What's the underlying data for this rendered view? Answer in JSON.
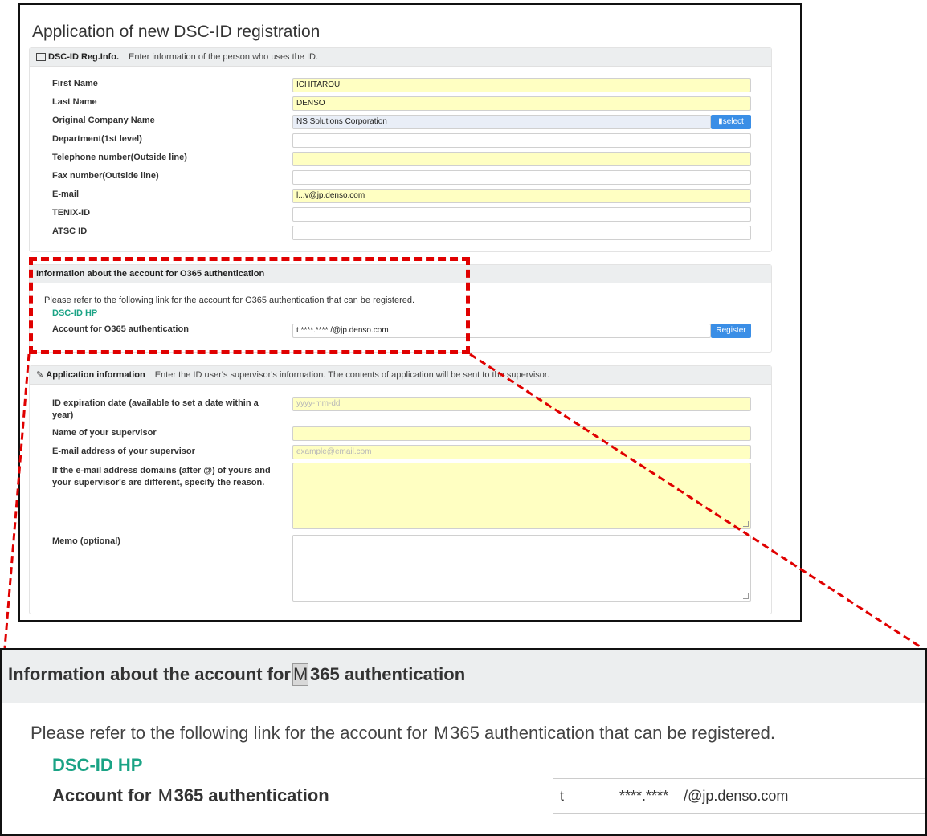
{
  "title": "Application of new DSC-ID registration",
  "reg_info": {
    "heading": "DSC-ID Reg.Info.",
    "description": "Enter information of the person who uses the ID.",
    "fields": [
      {
        "label": "First Name",
        "value": "ICHITAROU",
        "required": true
      },
      {
        "label": "Last Name",
        "value": "DENSO",
        "required": true
      },
      {
        "label": "Original Company Name",
        "value": "NS Solutions Corporation",
        "required": false
      },
      {
        "label": "Department(1st level)",
        "value": "",
        "required": false
      },
      {
        "label": "Telephone number(Outside line)",
        "value": "",
        "required": true
      },
      {
        "label": "Fax number(Outside line)",
        "value": "",
        "required": false
      },
      {
        "label": "E-mail",
        "value": "l...v@jp.denso.com",
        "required": true
      },
      {
        "label": "TENIX-ID",
        "value": "",
        "required": false
      },
      {
        "label": "ATSC ID",
        "value": "",
        "required": false
      }
    ],
    "select_button": "select"
  },
  "o365": {
    "heading": "Information about the account for O365 authentication",
    "note": "Please refer to the following link for the account for O365 authentication that can be registered.",
    "link": "DSC-ID HP",
    "account_label": "Account for O365 authentication",
    "account_value": "t ****.**** /@jp.denso.com",
    "register_button": "Register"
  },
  "application": {
    "heading": "Application information",
    "description": "Enter the ID user's supervisor's information. The contents of application will be sent to the supervisor.",
    "expiration_label": "ID expiration date (available to set a date within a year)",
    "expiration_placeholder": "yyyy-mm-dd",
    "supervisor_name_label": "Name of your supervisor",
    "supervisor_email_label": "E-mail address of your supervisor",
    "supervisor_email_placeholder": "example@email.com",
    "reason_label": "If the e-mail address domains (after @) of yours and your supervisor's are different, specify the reason.",
    "memo_label": "Memo (optional)"
  },
  "zoom": {
    "heading_pre": "Information about the account for",
    "heading_post": "365 authentication",
    "note_pre": "Please refer to the following link for the account for",
    "note_post": "365 authentication that can be registered.",
    "link": "DSC-ID HP",
    "account_pre": "Account for",
    "account_post": "365 authentication",
    "glyph": "M",
    "account_value_t": "t",
    "account_value_masked": "****.****",
    "account_value_domain": "/@jp.denso.com"
  },
  "colors": {
    "highlight": "#e00000",
    "required_field": "#ffffc2",
    "button": "#3a8ee6",
    "link": "#1aa385"
  }
}
